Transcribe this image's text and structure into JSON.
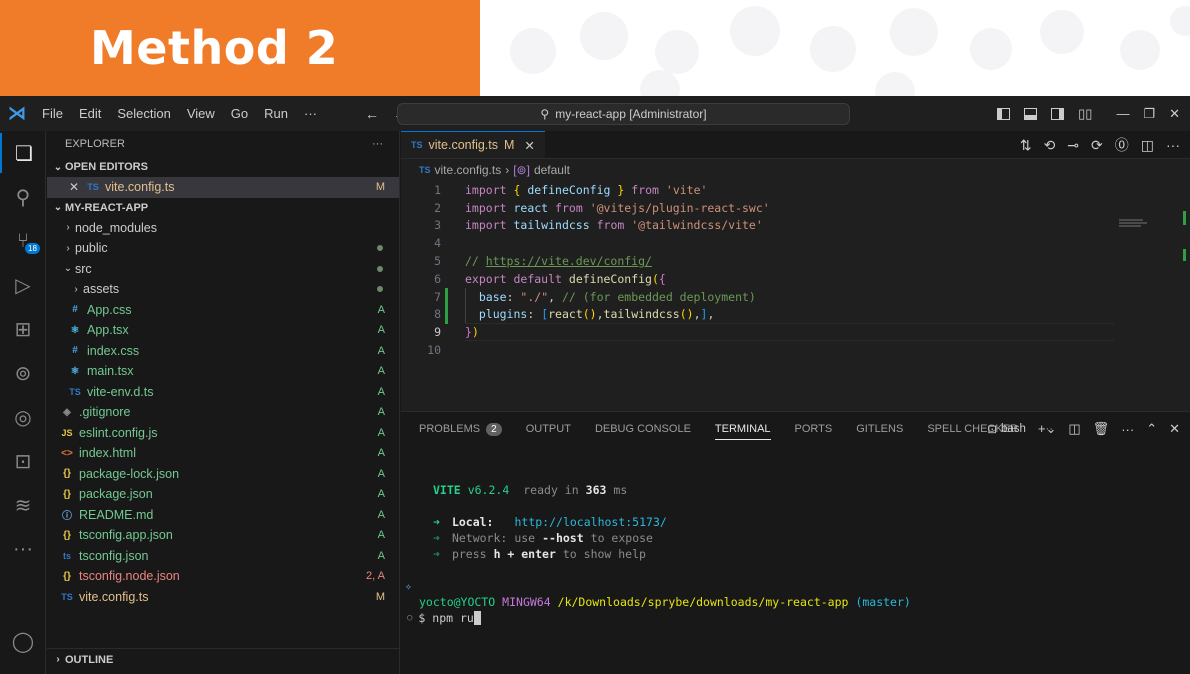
{
  "banner": {
    "title": "Method 2"
  },
  "titlebar": {
    "menu": [
      "File",
      "Edit",
      "Selection",
      "View",
      "Go",
      "Run",
      "···"
    ],
    "command_center": "my-react-app [Administrator]",
    "back_icon": "arrow-left-icon",
    "forward_icon": "arrow-right-icon"
  },
  "activity_bar": {
    "scm_badge": "18",
    "items": [
      "explorer-icon",
      "search-icon",
      "source-control-icon",
      "run-debug-icon",
      "extensions-icon",
      "git-graph-icon",
      "gitlens-icon",
      "remote-explorer-icon",
      "timeline-icon",
      "more-icon",
      "account-icon"
    ]
  },
  "sidebar": {
    "title": "EXPLORER",
    "more": "···",
    "open_editors_label": "OPEN EDITORS",
    "open_editor": {
      "icon": "TS",
      "name": "vite.config.ts",
      "status": "M"
    },
    "project_label": "MY-REACT-APP",
    "outline_label": "OUTLINE",
    "tree": [
      {
        "name": "node_modules",
        "icon": "folder"
      },
      {
        "name": "public",
        "icon": "folder"
      },
      {
        "name": "src",
        "icon": "folder-open"
      },
      {
        "name": "assets",
        "icon": "folder"
      },
      {
        "name": "App.css",
        "icon": "#",
        "status": "A"
      },
      {
        "name": "App.tsx",
        "icon": "react",
        "status": "A"
      },
      {
        "name": "index.css",
        "icon": "#",
        "status": "A"
      },
      {
        "name": "main.tsx",
        "icon": "react",
        "status": "A"
      },
      {
        "name": "vite-env.d.ts",
        "icon": "TS",
        "status": "A"
      },
      {
        "name": ".gitignore",
        "icon": "git",
        "status": "A"
      },
      {
        "name": "eslint.config.js",
        "icon": "JS",
        "status": "A"
      },
      {
        "name": "index.html",
        "icon": "<>",
        "status": "A"
      },
      {
        "name": "package-lock.json",
        "icon": "{}",
        "status": "A"
      },
      {
        "name": "package.json",
        "icon": "{}",
        "status": "A"
      },
      {
        "name": "README.md",
        "icon": "info",
        "status": "A"
      },
      {
        "name": "tsconfig.app.json",
        "icon": "{}",
        "status": "A"
      },
      {
        "name": "tsconfig.json",
        "icon": "ts",
        "status": "A"
      },
      {
        "name": "tsconfig.node.json",
        "icon": "{}",
        "status": "2, A"
      },
      {
        "name": "vite.config.ts",
        "icon": "TS",
        "status": "M"
      }
    ]
  },
  "editor": {
    "tab_label": "vite.config.ts",
    "tab_icon": "TS",
    "tab_status": "M",
    "close": "✕",
    "breadcrumb_file": "vite.config.ts",
    "breadcrumb_symbol": "default",
    "line_numbers": [
      "1",
      "2",
      "3",
      "4",
      "5",
      "6",
      "7",
      "8",
      "9",
      "10"
    ],
    "lines": [
      [
        [
          "kw",
          "import"
        ],
        [
          "pun",
          " "
        ],
        [
          "br",
          "{"
        ],
        [
          "pun",
          " "
        ],
        [
          "id",
          "defineConfig"
        ],
        [
          "pun",
          " "
        ],
        [
          "br",
          "}"
        ],
        [
          "pun",
          " "
        ],
        [
          "kw",
          "from"
        ],
        [
          "pun",
          " "
        ],
        [
          "str",
          "'vite'"
        ]
      ],
      [
        [
          "kw",
          "import"
        ],
        [
          "pun",
          " "
        ],
        [
          "id",
          "react"
        ],
        [
          "pun",
          " "
        ],
        [
          "kw",
          "from"
        ],
        [
          "pun",
          " "
        ],
        [
          "str",
          "'@vitejs/plugin-react-swc'"
        ]
      ],
      [
        [
          "kw",
          "import"
        ],
        [
          "pun",
          " "
        ],
        [
          "id",
          "tailwindcss"
        ],
        [
          "pun",
          " "
        ],
        [
          "kw",
          "from"
        ],
        [
          "pun",
          " "
        ],
        [
          "str",
          "'@tailwindcss/vite'"
        ]
      ],
      [],
      [
        [
          "cm",
          "// "
        ],
        [
          "url",
          "https://vite.dev/config/"
        ]
      ],
      [
        [
          "kw",
          "export"
        ],
        [
          "pun",
          " "
        ],
        [
          "kw",
          "default"
        ],
        [
          "pun",
          " "
        ],
        [
          "fn",
          "defineConfig"
        ],
        [
          "br",
          "("
        ],
        [
          "br2",
          "{"
        ]
      ],
      [
        [
          "pun",
          "  "
        ],
        [
          "id",
          "base"
        ],
        [
          "pun",
          ": "
        ],
        [
          "str",
          "\"./\""
        ],
        [
          "pun",
          ", "
        ],
        [
          "cm",
          "// (for embedded deployment)"
        ]
      ],
      [
        [
          "pun",
          "  "
        ],
        [
          "id",
          "plugins"
        ],
        [
          "pun",
          ": "
        ],
        [
          "br3",
          "["
        ],
        [
          "fn",
          "react"
        ],
        [
          "br",
          "()"
        ],
        [
          "pun",
          ","
        ],
        [
          "fn",
          "tailwindcss"
        ],
        [
          "br",
          "()"
        ],
        [
          "pun",
          ","
        ],
        [
          "br3",
          "]"
        ],
        [
          "pun",
          ","
        ]
      ],
      [
        [
          "br2",
          "}"
        ],
        [
          "br",
          ")"
        ]
      ],
      []
    ]
  },
  "panel": {
    "tabs": [
      "PROBLEMS",
      "OUTPUT",
      "DEBUG CONSOLE",
      "TERMINAL",
      "PORTS",
      "GITLENS",
      "SPELL CHECKER",
      "···"
    ],
    "problems_count": "2",
    "active_tab": "TERMINAL",
    "shell": "bash"
  },
  "terminal": {
    "vite_name": "VITE",
    "vite_version": "v6.2.4",
    "ready_text": "ready in",
    "ready_ms": "363",
    "ready_unit": "ms",
    "local_label": "Local:",
    "local_url": "http://localhost:5173/",
    "network_label": "Network:",
    "network_text_a": "use",
    "network_flag": "--host",
    "network_text_b": "to expose",
    "help_a": "press",
    "help_key": "h + enter",
    "help_b": "to show help",
    "prompt_user": "yocto@YOCTO",
    "prompt_env": "MINGW64",
    "prompt_path": "/k/Downloads/sprybe/downloads/my-react-app",
    "prompt_branch": "(master)",
    "command": "$ npm ru"
  }
}
